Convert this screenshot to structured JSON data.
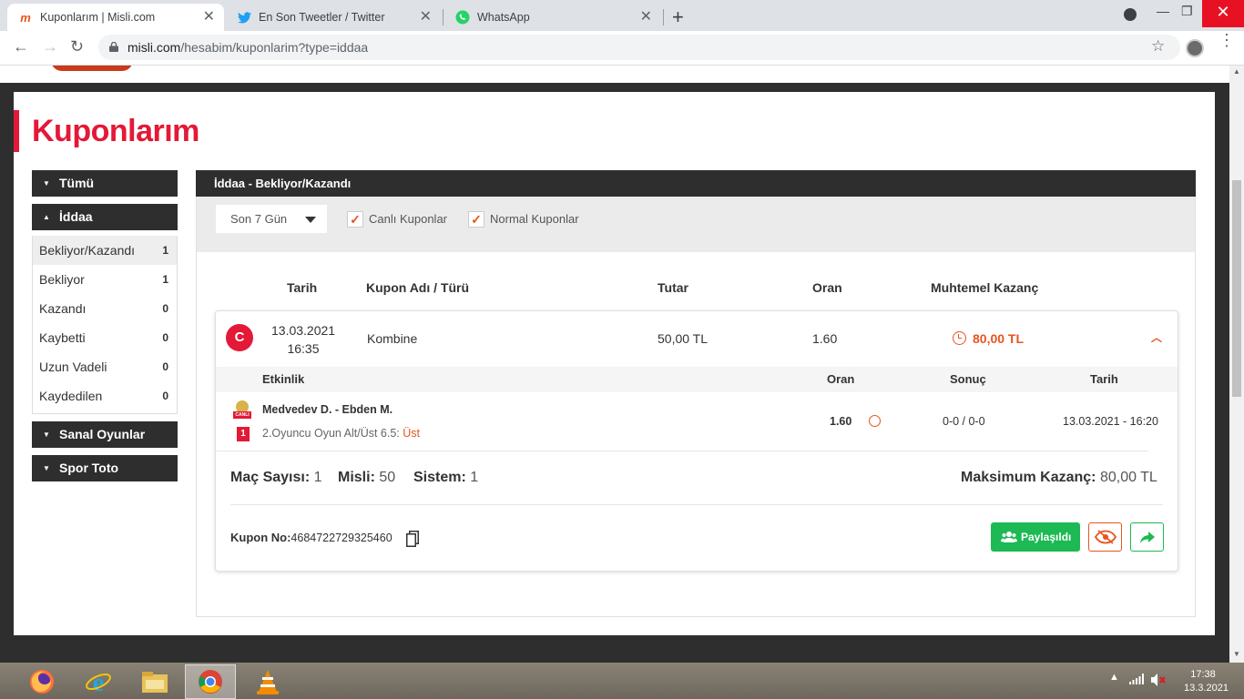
{
  "browser": {
    "tabs": [
      {
        "title": "Kuponlarım | Misli.com",
        "favicon": "misli-icon",
        "active": true
      },
      {
        "title": "En Son Tweetler / Twitter",
        "favicon": "twitter-icon",
        "active": false
      },
      {
        "title": "WhatsApp",
        "favicon": "whatsapp-icon",
        "active": false
      }
    ],
    "url_host": "misli.com",
    "url_path": "/hesabim/kuponlarim?type=iddaa"
  },
  "page": {
    "title": "Kuponlarım",
    "accent": "#e31937",
    "orange": "#e8541e",
    "green": "#1db954"
  },
  "sidebar": {
    "tumu": "Tümü",
    "iddaa": "İddaa",
    "items": [
      {
        "label": "Bekliyor/Kazandı",
        "count": "1",
        "selected": true
      },
      {
        "label": "Bekliyor",
        "count": "1"
      },
      {
        "label": "Kazandı",
        "count": "0"
      },
      {
        "label": "Kaybetti",
        "count": "0"
      },
      {
        "label": "Uzun Vadeli",
        "count": "0"
      },
      {
        "label": "Kaydedilen",
        "count": "0"
      }
    ],
    "sanal": "Sanal Oyunlar",
    "spor_toto": "Spor Toto"
  },
  "main": {
    "header": "İddaa - Bekliyor/Kazandı",
    "filter": {
      "period": "Son 7 Gün",
      "canli": "Canlı Kuponlar",
      "normal": "Normal Kuponlar"
    },
    "columns": {
      "tarih": "Tarih",
      "kupon": "Kupon Adı / Türü",
      "tutar": "Tutar",
      "oran": "Oran",
      "kazanc": "Muhtemel Kazanç"
    }
  },
  "coupon": {
    "badge": "C",
    "date": "13.03.2021",
    "time": "16:35",
    "type": "Kombine",
    "amount": "50,00 TL",
    "odds": "1.60",
    "potential": "80,00 TL",
    "event_columns": {
      "etkinlik": "Etkinlik",
      "oran": "Oran",
      "sonuc": "Sonuç",
      "tarih": "Tarih"
    },
    "event": {
      "live_label": "CANLI",
      "number": "1",
      "match": "Medvedev D. - Ebden M.",
      "market": "2.Oyuncu Oyun Alt/Üst 6.5:",
      "pick": "Üst",
      "odds": "1.60",
      "score": "0-0 / 0-0",
      "datetime": "13.03.2021 - 16:20"
    },
    "stats": {
      "mac_label": "Maç Sayısı:",
      "mac_value": "1",
      "misli_label": "Misli:",
      "misli_value": "50",
      "sistem_label": "Sistem:",
      "sistem_value": "1",
      "max_label": "Maksimum Kazanç:",
      "max_value": "80,00 TL"
    },
    "kupon_no_label": "Kupon No:",
    "kupon_no": "4684722729325460",
    "share_label": "Paylaşıldı"
  },
  "taskbar": {
    "time": "17:38",
    "date": "13.3.2021"
  }
}
